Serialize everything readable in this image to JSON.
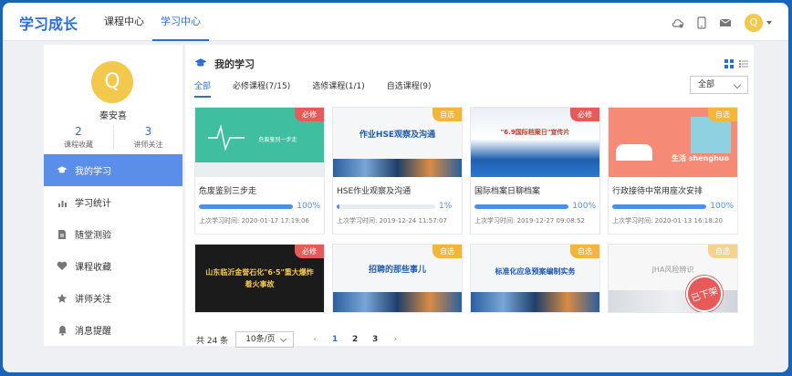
{
  "header": {
    "brand": "学习成长",
    "tabs": [
      {
        "label": "课程中心"
      },
      {
        "label": "学习中心"
      }
    ],
    "user_initial": "Q"
  },
  "user": {
    "initial": "Q",
    "name": "秦安喜",
    "stats": [
      {
        "value": "2",
        "label": "课程收藏"
      },
      {
        "value": "3",
        "label": "讲师关注"
      }
    ]
  },
  "menu": [
    {
      "label": "我的学习",
      "icon": "graduation-cap-icon"
    },
    {
      "label": "学习统计",
      "icon": "bar-chart-icon"
    },
    {
      "label": "随堂测验",
      "icon": "document-icon"
    },
    {
      "label": "课程收藏",
      "icon": "heart-icon"
    },
    {
      "label": "讲师关注",
      "icon": "star-icon"
    },
    {
      "label": "消息提醒",
      "icon": "bell-icon"
    }
  ],
  "main": {
    "title": "我的学习",
    "filters": [
      "全部",
      "必修课程(7/15)",
      "选修课程(1/1)",
      "自选课程(9)"
    ],
    "select_value": "全部"
  },
  "courses": [
    {
      "badge": "必修",
      "thumb_text": "危废鉴别一步走",
      "title": "危废鉴别三步走",
      "progress": 100,
      "progress_label": "100%",
      "last_time": "上次学习时间: 2020-01-17 17:19:06"
    },
    {
      "badge": "自选",
      "thumb_text": "作业HSE观察及沟通",
      "title": "HSE作业观察及沟通",
      "progress": 1,
      "progress_label": "1%",
      "last_time": "上次学习时间: 2019-12-24 11:57:07"
    },
    {
      "badge": "必修",
      "thumb_text": "\"6.9国际档案日\"宣传片",
      "title": "国际档案日聊档案",
      "progress": 100,
      "progress_label": "100%",
      "last_time": "上次学习时间: 2019-12-27 09:08:52"
    },
    {
      "badge": "自选",
      "thumb_text": "生活 shenghuo",
      "title": "行政接待中常用座次安排",
      "progress": 100,
      "progress_label": "100%",
      "last_time": "上次学习时间: 2020-01-13 16:18:20"
    },
    {
      "badge": "必修",
      "thumb_text": "山东临沂金誉石化\"6·5\"重大爆炸着火事故",
      "title": "",
      "progress": null,
      "progress_label": "",
      "last_time": ""
    },
    {
      "badge": "自选",
      "thumb_text": "招聘的那些事儿",
      "title": "",
      "progress": null,
      "progress_label": "",
      "last_time": ""
    },
    {
      "badge": "自选",
      "thumb_text": "标准化应急预案编制实务",
      "title": "",
      "progress": null,
      "progress_label": "",
      "last_time": ""
    },
    {
      "badge": "自选",
      "thumb_text": "JHA风险辨识",
      "stamp": "已下架",
      "title": "",
      "progress": null,
      "progress_label": "",
      "last_time": ""
    }
  ],
  "pager": {
    "total": "共 24 条",
    "page_size": "10条/页",
    "pages": [
      "1",
      "2",
      "3"
    ],
    "current": "1"
  },
  "colors": {
    "accent": "#2a6fd6",
    "required": "#e75a5a",
    "optional": "#f3b63b",
    "active_menu": "#5b8ee8"
  }
}
